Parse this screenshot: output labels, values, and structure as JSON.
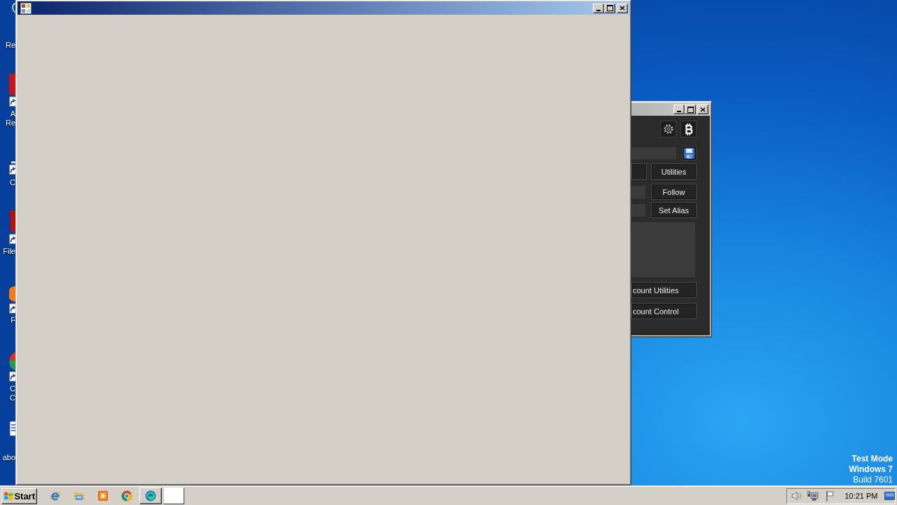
{
  "desktop": {
    "shortcuts": [
      {
        "kind": "bin",
        "label_lines": [
          "Re"
        ]
      },
      {
        "kind": "reader",
        "label_lines": [
          "A",
          "Re"
        ]
      },
      {
        "kind": "cleaner",
        "label_lines": [
          "C"
        ]
      },
      {
        "kind": "ftp",
        "label_lines": [
          "File"
        ]
      },
      {
        "kind": "fox",
        "label_lines": [
          "F"
        ]
      },
      {
        "kind": "browser",
        "label_lines": [
          "C",
          "C"
        ]
      },
      {
        "kind": "document",
        "label_lines": [
          "abo"
        ]
      }
    ],
    "notice": [
      "Test Mode",
      "Windows 7",
      "Build 7601"
    ]
  },
  "app_window": {
    "active": true
  },
  "tool_window": {
    "active": false,
    "rows": [
      {
        "kind": "button",
        "button": "Utilities"
      },
      {
        "kind": "field",
        "button": "Follow"
      },
      {
        "kind": "field",
        "button": "Set Alias"
      }
    ],
    "wide_buttons": [
      "count Utilities",
      "count Control"
    ]
  },
  "taskbar": {
    "start": "Start",
    "clock": "10:21 PM"
  }
}
